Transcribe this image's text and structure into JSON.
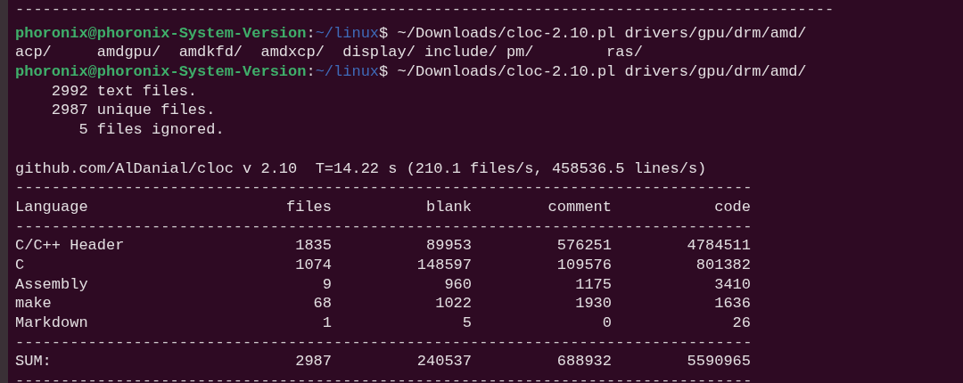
{
  "terminal": {
    "lines": [
      {
        "kind": "rule",
        "text": "------------------------------------------------------------------------------------------"
      },
      {
        "kind": "prompt",
        "user_host": "phoronix@phoronix-System-Version",
        "separator": ":",
        "path": "~/linux",
        "command": "$ ~/Downloads/cloc-2.10.pl drivers/gpu/drm/amd/"
      },
      {
        "kind": "output",
        "text": "acp/     amdgpu/  amdkfd/  amdxcp/  display/ include/ pm/        ras/"
      },
      {
        "kind": "prompt",
        "user_host": "phoronix@phoronix-System-Version",
        "separator": ":",
        "path": "~/linux",
        "command": "$ ~/Downloads/cloc-2.10.pl drivers/gpu/drm/amd/"
      },
      {
        "kind": "output",
        "text": "    2992 text files."
      },
      {
        "kind": "output",
        "text": "    2987 unique files."
      },
      {
        "kind": "output",
        "text": "       5 files ignored."
      },
      {
        "kind": "blank"
      },
      {
        "kind": "output",
        "text": "github.com/AlDanial/cloc v 2.10  T=14.22 s (210.1 files/s, 458536.5 lines/s)"
      },
      {
        "kind": "rule",
        "text": "---------------------------------------------------------------------------------"
      },
      {
        "kind": "table_row",
        "cells": [
          "Language",
          "files",
          "blank",
          "comment",
          "code"
        ]
      },
      {
        "kind": "rule",
        "text": "---------------------------------------------------------------------------------"
      },
      {
        "kind": "table_row",
        "cells": [
          "C/C++ Header",
          "1835",
          "89953",
          "576251",
          "4784511"
        ]
      },
      {
        "kind": "table_row",
        "cells": [
          "C",
          "1074",
          "148597",
          "109576",
          "801382"
        ]
      },
      {
        "kind": "table_row",
        "cells": [
          "Assembly",
          "9",
          "960",
          "1175",
          "3410"
        ]
      },
      {
        "kind": "table_row",
        "cells": [
          "make",
          "68",
          "1022",
          "1930",
          "1636"
        ]
      },
      {
        "kind": "table_row",
        "cells": [
          "Markdown",
          "1",
          "5",
          "0",
          "26"
        ]
      },
      {
        "kind": "rule",
        "text": "---------------------------------------------------------------------------------"
      },
      {
        "kind": "table_row",
        "cells": [
          "SUM:",
          "2987",
          "240537",
          "688932",
          "5590965"
        ]
      },
      {
        "kind": "rule",
        "text": "---------------------------------------------------------------------------------"
      }
    ]
  }
}
